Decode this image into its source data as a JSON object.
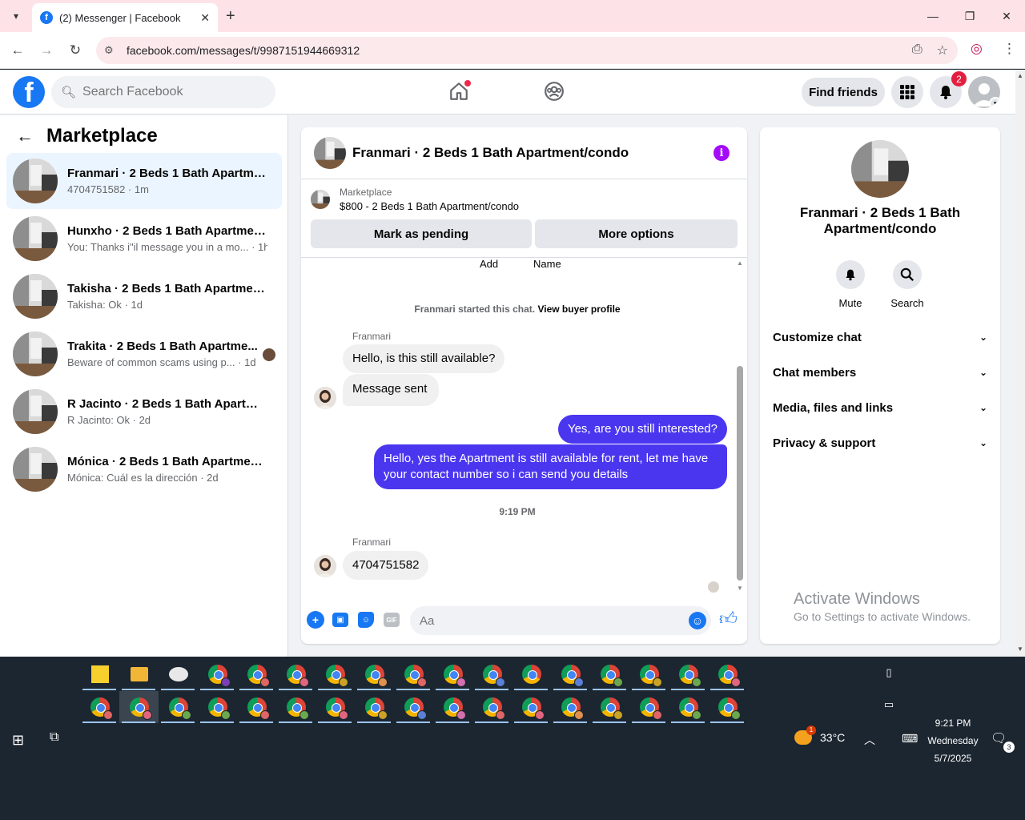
{
  "browser": {
    "tab_title": "(2) Messenger | Facebook",
    "url": "facebook.com/messages/t/9987151944669312"
  },
  "fb_header": {
    "search_placeholder": "Search Facebook",
    "find_friends": "Find friends",
    "notification_count": "2"
  },
  "sidebar": {
    "title": "Marketplace",
    "conversations": [
      {
        "title": "Franmari · 2 Beds 1 Bath Apartmen...",
        "subtitle": "4704751582 · 1m"
      },
      {
        "title": "Hunxho · 2 Beds 1 Bath Apartment...",
        "subtitle": "You: Thanks i\"il message you in a mo... · 1h"
      },
      {
        "title": "Takisha · 2 Beds 1 Bath Apartment/...",
        "subtitle": "Takisha: Ok · 1d"
      },
      {
        "title": "Trakita · 2 Beds 1 Bath Apartme...",
        "subtitle": "Beware of common scams using p... · 1d"
      },
      {
        "title": "R Jacinto · 2 Beds 1 Bath Apartmen...",
        "subtitle": "R Jacinto: Ok · 2d"
      },
      {
        "title": "Mónica · 2 Beds 1 Bath Apartment...",
        "subtitle": "Mónica: Cuál es la dirección · 2d"
      }
    ]
  },
  "chat": {
    "title": "Franmari · 2 Beds 1 Bath Apartment/condo",
    "listing_source": "Marketplace",
    "listing_name": "$800 - 2 Beds 1 Bath Apartment/condo",
    "mark_pending": "Mark as pending",
    "more_options": "More options",
    "cut_label_1": "Add",
    "cut_label_2": "Name",
    "system_message": "Franmari started this chat.",
    "view_buyer_profile": "View buyer profile",
    "sender_name": "Franmari",
    "msg_1": "Hello, is this still available?",
    "msg_2": "Message sent",
    "msg_3": "Yes, are you still interested?",
    "msg_4": "Hello, yes the Apartment is still available for rent, let me have your contact number so i can send you details",
    "timestamp": "9:19 PM",
    "msg_5": "4704751582",
    "composer_placeholder": "Aa"
  },
  "info_panel": {
    "title": "Franmari · 2 Beds 1 Bath Apartment/condo",
    "mute": "Mute",
    "search": "Search",
    "sections": [
      "Customize chat",
      "Chat members",
      "Media, files and links",
      "Privacy & support"
    ]
  },
  "watermark": {
    "line1": "Activate Windows",
    "line2": "Go to Settings to activate Windows."
  },
  "taskbar": {
    "temperature": "33°C",
    "time": "9:21 PM",
    "day": "Wednesday",
    "date": "5/7/2025",
    "weather_badge": "1",
    "notification_count": "3"
  },
  "colors": {
    "fb_blue": "#1877f2",
    "outgoing_bubble": "#4b36f0",
    "info_purple": "#a40bf8",
    "badge_red": "#e41e3f"
  }
}
